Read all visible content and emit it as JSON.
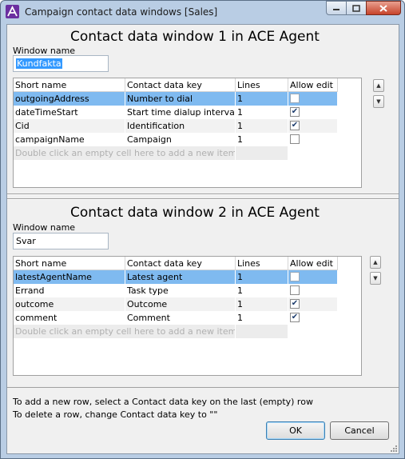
{
  "window": {
    "title": "Campaign contact data windows [Sales]"
  },
  "pane1": {
    "title": "Contact data window 1 in ACE Agent",
    "window_name_label": "Window name",
    "window_name_value": "Kundfakta",
    "columns": [
      "Short name",
      "Contact data key",
      "Lines",
      "Allow edit"
    ],
    "rows": [
      {
        "short_name": "outgoingAddress",
        "key": "Number to dial",
        "lines": "1",
        "allow_edit": false,
        "selected": true
      },
      {
        "short_name": "dateTimeStart",
        "key": "Start time dialup interval",
        "lines": "1",
        "allow_edit": true
      },
      {
        "short_name": "Cid",
        "key": "Identification",
        "lines": "1",
        "allow_edit": true
      },
      {
        "short_name": "campaignName",
        "key": "Campaign",
        "lines": "1",
        "allow_edit": false
      }
    ],
    "empty_row_hint": "Double click an empty cell here to add a new item."
  },
  "pane2": {
    "title": "Contact data window 2 in ACE Agent",
    "window_name_label": "Window name",
    "window_name_value": "Svar",
    "columns": [
      "Short name",
      "Contact data key",
      "Lines",
      "Allow edit"
    ],
    "rows": [
      {
        "short_name": "latestAgentName",
        "key": "Latest agent",
        "lines": "1",
        "allow_edit": false,
        "selected": true
      },
      {
        "short_name": "Errand",
        "key": "Task type",
        "lines": "1",
        "allow_edit": false
      },
      {
        "short_name": "outcome",
        "key": "Outcome",
        "lines": "1",
        "allow_edit": true
      },
      {
        "short_name": "comment",
        "key": "Comment",
        "lines": "1",
        "allow_edit": true
      }
    ],
    "empty_row_hint": "Double click an empty cell here to add a new item."
  },
  "info": {
    "line1": "To add a new row, select a Contact data key on the last (empty) row",
    "line2": "To delete a row, change Contact data key to \"\""
  },
  "buttons": {
    "ok": "OK",
    "cancel": "Cancel"
  },
  "icons": {
    "app": "ace-logo-icon",
    "minimize": "minimize-icon",
    "maximize": "maximize-icon",
    "close": "close-icon",
    "up": "arrow-up-icon",
    "down": "arrow-down-icon"
  },
  "colors": {
    "selected_row": "#7fbaf0",
    "title_bar": "#b9cde4",
    "close_button": "#c6432a"
  }
}
